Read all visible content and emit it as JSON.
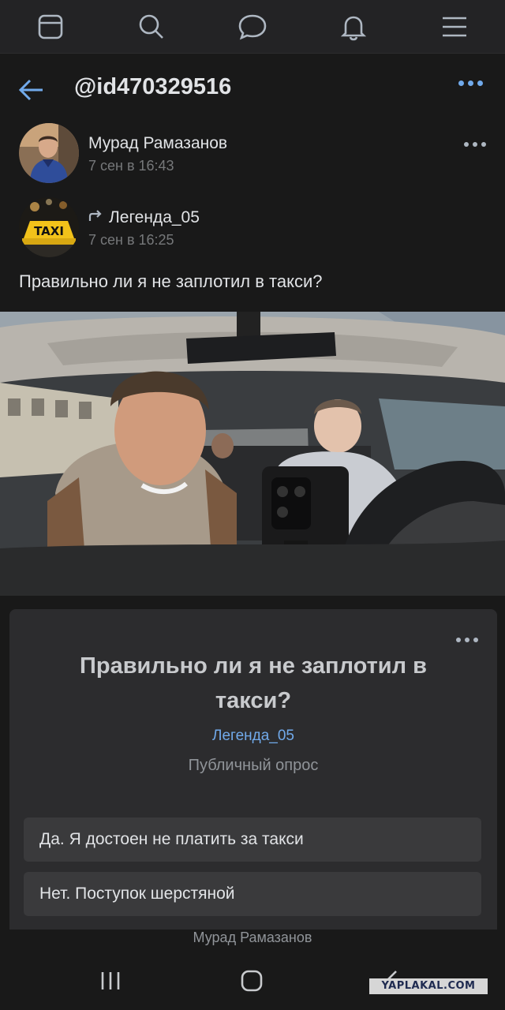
{
  "topnav": {
    "items": [
      {
        "icon": "feed-icon"
      },
      {
        "icon": "search-icon"
      },
      {
        "icon": "messages-icon"
      },
      {
        "icon": "bell-icon"
      },
      {
        "icon": "menu-icon"
      }
    ]
  },
  "header": {
    "handle": "@id470329516"
  },
  "post": {
    "author_name": "Мурад Рамазанов",
    "author_date": "7 сен в 16:43",
    "repost_name": "Легенда_05",
    "repost_date": "7 сен в 16:25",
    "text": "Правильно ли я не заплотил в такси?",
    "taxi_sign": "TAXI"
  },
  "poll": {
    "title": "Правильно ли я не заплотил в такси?",
    "author": "Легенда_05",
    "type": "Публичный опрос",
    "options": [
      {
        "label": "Да. Я достоен не платить за такси"
      },
      {
        "label": "Нет. Поступок шерстяной"
      }
    ]
  },
  "caption": "Мурад Рамазанов",
  "watermark": "YAPLAKAL.COM",
  "colors": {
    "accent": "#71aaeb",
    "background": "#191919",
    "card": "#2c2c2e"
  }
}
